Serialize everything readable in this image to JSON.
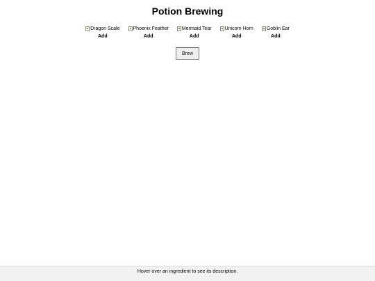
{
  "page": {
    "title": "Potion Brewing"
  },
  "ingredients": [
    {
      "alt": "Dragon Scale",
      "add_label": "Add"
    },
    {
      "alt": "Phoenix Feather",
      "add_label": "Add"
    },
    {
      "alt": "Mermaid Tear",
      "add_label": "Add"
    },
    {
      "alt": "Unicorn Horn",
      "add_label": "Add"
    },
    {
      "alt": "Goblin Ear",
      "add_label": "Add"
    }
  ],
  "brew_button": {
    "label": "Brew"
  },
  "footer": {
    "description": "Hover over an ingredient to see its description."
  }
}
